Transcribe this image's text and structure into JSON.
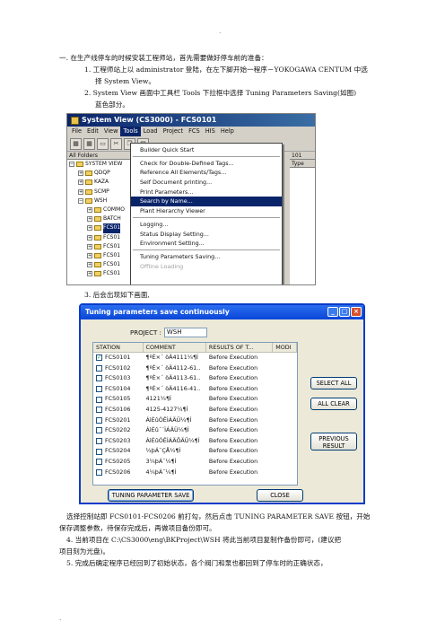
{
  "page": {
    "top_mark": ".",
    "bottom_mark": ".",
    "intro": "一. 在生产线停车的时候安装工程师站，首先需要做好停车前的准备：",
    "step1": "1.   工程师站上以 administrator 登陆，在左下脚开始一程序－YOKOGAWA CENTUM 中选",
    "step1_cont": "择 System View。",
    "step2": "2.   System View 画面中工具栏 Tools 下拉框中选择 Tuning Parameters Saving(如图)",
    "step2_cont": "蓝色部分。",
    "step3": "3.   后会出现如下画面,",
    "para_select": "选择控制站即 FCS0101-FCS0206 前打勾，然后点击 TUNING PARAMETER SAVE 按钮，开始",
    "para_select_cont": "保存调整参数，待保存完成后，再做项目备份即可。",
    "para4": "4. 当前项目在 C:\\CS3000\\eng\\BKProject\\WSH 将此当前项目复制作备份即可，(建议把",
    "para4_cont": "项目刻为光盘)。",
    "para5": "5. 完成后确定程序已经回到了初始状态，各个阀门和泵也都回到了停车时的正确状态，"
  },
  "system_view": {
    "title": "System View (CS3000) - FCS0101",
    "menu": [
      "File",
      "Edit",
      "View",
      "Tools",
      "Load",
      "Project",
      "FCS",
      "HIS",
      "Help"
    ],
    "toolbar_icons": [
      "grid-icon",
      "grid-icon",
      "open-folder-icon",
      "cut-icon",
      "copy-icon",
      "paste-icon"
    ],
    "tree_header": "All Folders",
    "tree": [
      {
        "pm": "−",
        "label": "SYSTEM VIEW"
      },
      {
        "pm": "+",
        "label": "QDQP"
      },
      {
        "pm": "+",
        "label": "KAZA"
      },
      {
        "pm": "+",
        "label": "SCMP"
      },
      {
        "pm": "−",
        "label": "WSH"
      },
      {
        "pm": "+",
        "label": "COMMO"
      },
      {
        "pm": "+",
        "label": "BATCH"
      },
      {
        "pm": "+",
        "label": "FCS01"
      },
      {
        "pm": "+",
        "label": "FCS01"
      },
      {
        "pm": "+",
        "label": "FCS01"
      },
      {
        "pm": "+",
        "label": "FCS01"
      },
      {
        "pm": "+",
        "label": "FCS01"
      },
      {
        "pm": "+",
        "label": "FCS01"
      }
    ],
    "right_header_1": "101",
    "right_header_2": "Type",
    "tools_menu": {
      "builder": "Builder Quick Start",
      "check": "Check for Double-Defined Tags...",
      "reference": "Reference All Elements/Tags...",
      "self_doc": "Self Document printing...",
      "print_params": "Print Parameters...",
      "search": "Search by Name...",
      "plant": "Plant Hierarchy Viewer",
      "logging": "Logging...",
      "status": "Status Display Setting...",
      "environment": "Environment Setting...",
      "tuning": "Tuning Parameters Saving...",
      "offline": "Offline Loading"
    }
  },
  "dialog": {
    "title": "Tuning parameters save continuously",
    "project_label": "PROJECT :",
    "project_value": "WSH",
    "columns": [
      "STATION",
      "COMMENT",
      "RESULTS OF T...",
      "MODI"
    ],
    "rows": [
      {
        "station": "FCS0101",
        "comment": "¶ºÈ×´ öÄ4111¼¶Í",
        "result": "Before Execution",
        "checked": true
      },
      {
        "station": "FCS0102",
        "comment": "¶ºÈ×´ öÄ4112-61..",
        "result": "Before Execution",
        "checked": false
      },
      {
        "station": "FCS0103",
        "comment": "¶ºÈ×´ öÄ4113-61..",
        "result": "Before Execution",
        "checked": false
      },
      {
        "station": "FCS0104",
        "comment": "¶ºÈ×´ öÄ4116-41..",
        "result": "Before Execution",
        "checked": false
      },
      {
        "station": "FCS0105",
        "comment": "4121¼¶Í",
        "result": "Before Execution",
        "checked": false
      },
      {
        "station": "FCS0106",
        "comment": "4125-4127¼¶Í",
        "result": "Before Execution",
        "checked": false
      },
      {
        "station": "FCS0201",
        "comment": "ÁìÉûÒÊÌÁÄÜ¼¶Í",
        "result": "Before Execution",
        "checked": false
      },
      {
        "station": "FCS0202",
        "comment": "ÁìÉû´¨ÌÁÄÜ¼¶Í",
        "result": "Before Execution",
        "checked": false
      },
      {
        "station": "FCS0203",
        "comment": "ÁìÉûÒÊÌÁÄÔÄÜ¼¶Í",
        "result": "Before Execution",
        "checked": false
      },
      {
        "station": "FCS0204",
        "comment": "¼þÁ¯ÇÅ¼¶Í",
        "result": "Before Execution",
        "checked": false
      },
      {
        "station": "FCS0205",
        "comment": "3¼þÁ¯¼¶Í",
        "result": "Before Execution",
        "checked": false
      },
      {
        "station": "FCS0206",
        "comment": "4¼þÁ¯¼¶Í",
        "result": "Before Execution",
        "checked": false
      }
    ],
    "select_all": "SELECT ALL",
    "all_clear": "ALL CLEAR",
    "previous_result_1": "PREVIOUS",
    "previous_result_2": "RESULT",
    "tuning_save": "TUNING PARAMETER SAVE",
    "close": "CLOSE"
  }
}
